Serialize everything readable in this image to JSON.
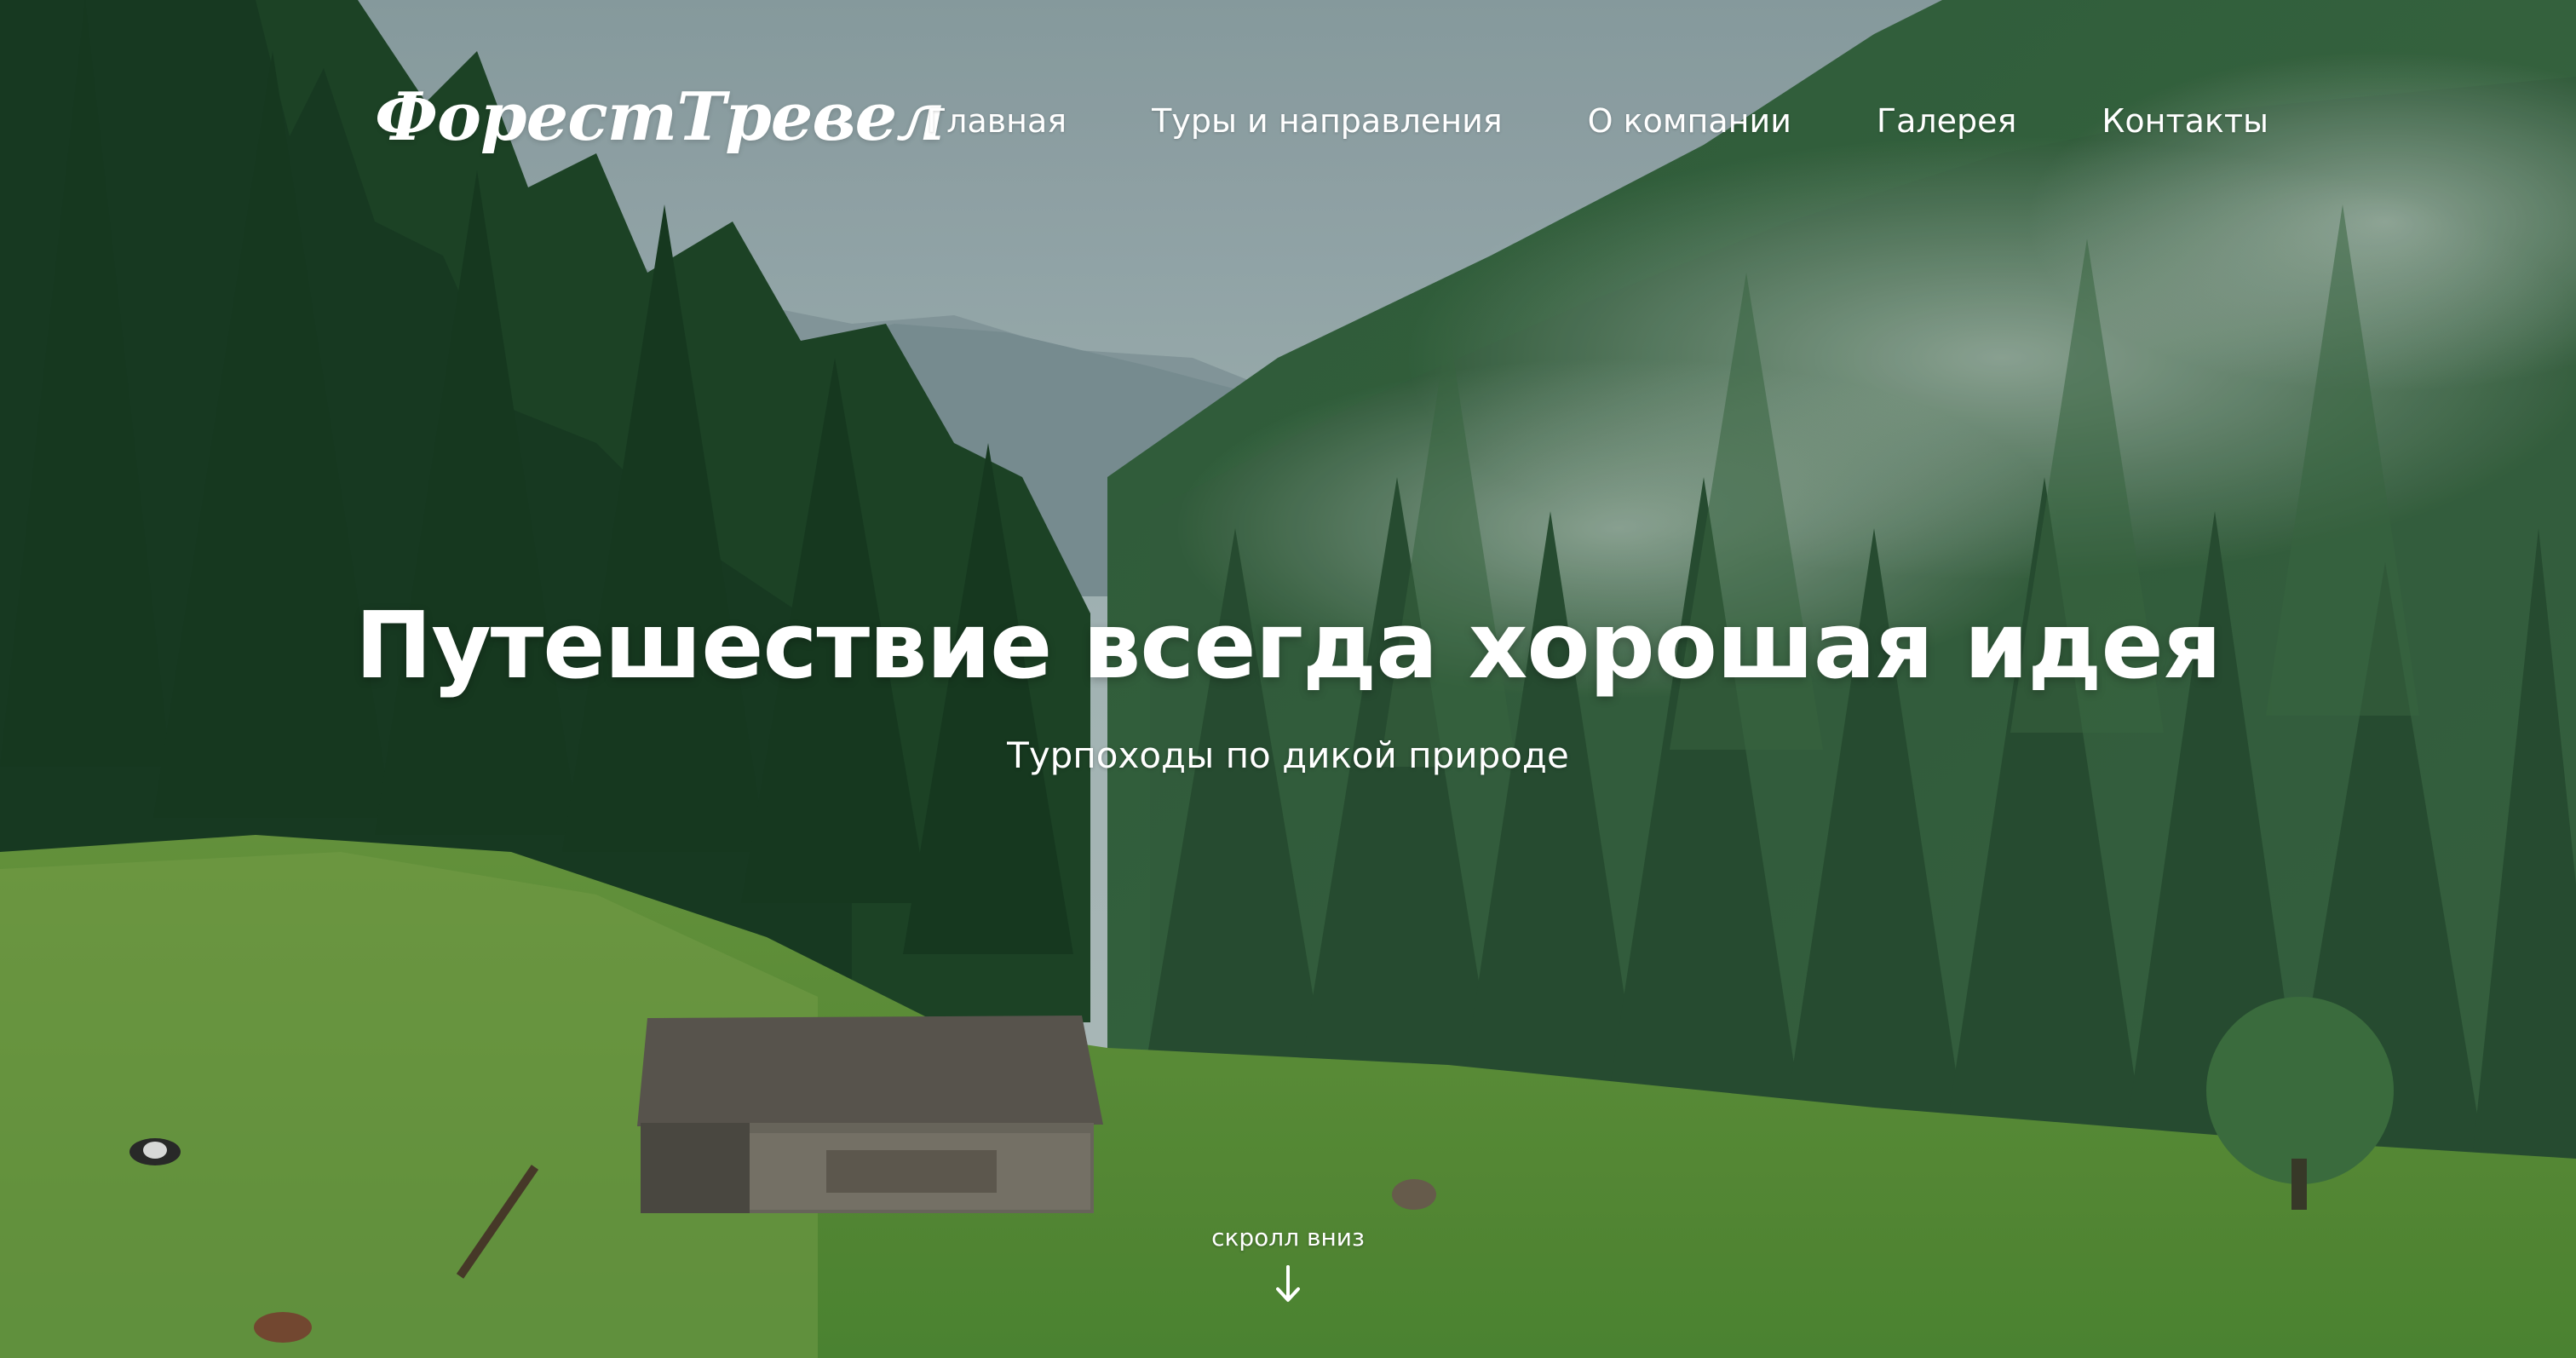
{
  "header": {
    "logo_text": "ФорестТревел",
    "nav": [
      {
        "label": "Главная"
      },
      {
        "label": "Туры и направления"
      },
      {
        "label": "О компании"
      },
      {
        "label": "Галерея"
      },
      {
        "label": "Контакты"
      }
    ]
  },
  "hero": {
    "title": "Путешествие всегда хорошая идея",
    "subtitle": "Турпоходы по дикой природе",
    "scroll_label": "скролл вниз",
    "scroll_icon": "arrow-down-icon",
    "background_image": "forest-valley-with-cabin-photo"
  },
  "colors": {
    "text": "#ffffff",
    "sky": "#a9bbbd",
    "forest_dark": "#1f4a2b",
    "meadow": "#5e9c3c"
  }
}
